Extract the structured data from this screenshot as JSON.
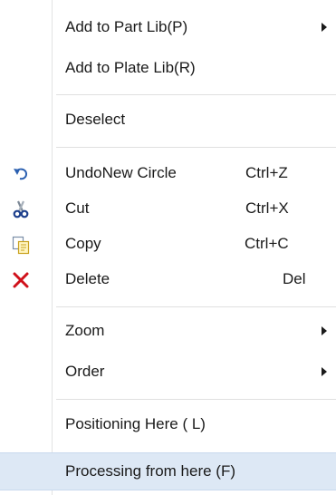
{
  "menu": {
    "items": [
      {
        "label": "Add to Part Lib(P)"
      },
      {
        "label": "Add to Plate Lib(R)"
      },
      {
        "label": "Deselect"
      },
      {
        "label": "UndoNew Circle",
        "shortcut": "Ctrl+Z",
        "icon": "undo-icon"
      },
      {
        "label": "Cut",
        "shortcut": "Ctrl+X",
        "icon": "cut-icon"
      },
      {
        "label": "Copy",
        "shortcut": "Ctrl+C",
        "icon": "copy-icon"
      },
      {
        "label": "Delete",
        "shortcut": "Del",
        "icon": "delete-icon"
      },
      {
        "label": "Zoom"
      },
      {
        "label": "Order"
      },
      {
        "label": "Positioning Here ( L)"
      },
      {
        "label": "Processing from here (F)"
      }
    ]
  },
  "colors": {
    "highlight": "#dde8f5",
    "delete_icon": "#d0101a",
    "undo_icon": "#2a5fb0"
  }
}
